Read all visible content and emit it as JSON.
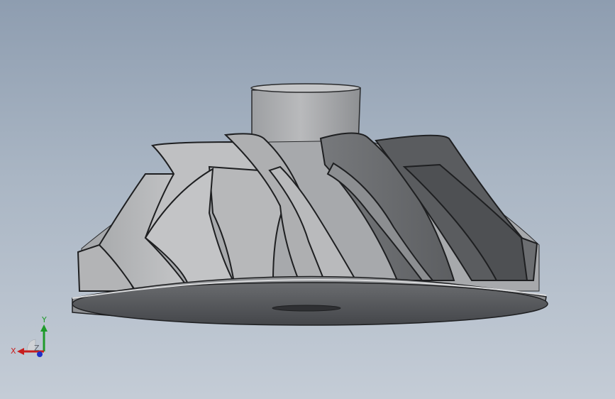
{
  "viewport": {
    "background_top": "#8e9db0",
    "background_bottom": "#c4ccd6"
  },
  "model": {
    "part_color": "#b8b9bb",
    "shadow_color": "#4d4e50"
  },
  "triad": {
    "x_label": "X",
    "y_label": "Y",
    "z_label": "Z",
    "x_color": "#c81e1e",
    "y_color": "#1e9a2a",
    "z_color": "#1e2fc8"
  }
}
